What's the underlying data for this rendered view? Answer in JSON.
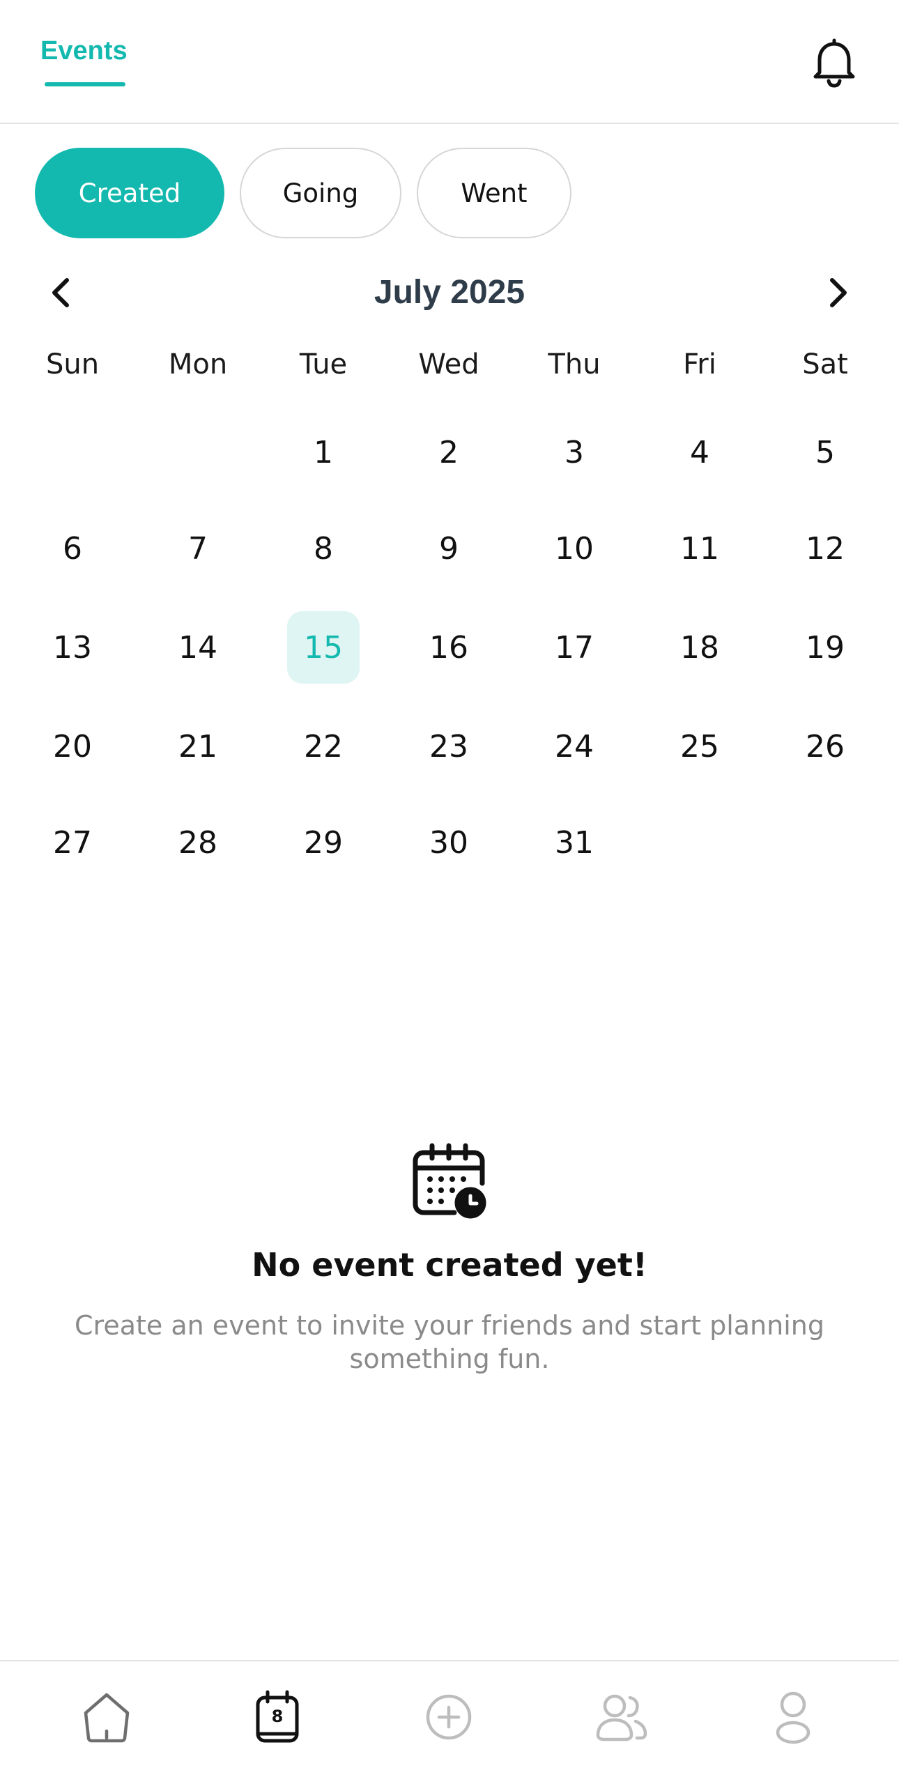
{
  "header": {
    "active_tab": "Events",
    "accent": "#13b9ae",
    "bell_icon": "bell-icon"
  },
  "filters": [
    {
      "label": "Created",
      "active": true
    },
    {
      "label": "Going",
      "active": false
    },
    {
      "label": "Went",
      "active": false
    }
  ],
  "calendar": {
    "month_label": "July 2025",
    "prev_icon": "chevron-left-icon",
    "next_icon": "chevron-right-icon",
    "weekdays": [
      "Sun",
      "Mon",
      "Tue",
      "Wed",
      "Thu",
      "Fri",
      "Sat"
    ],
    "days": [
      "",
      "",
      "1",
      "2",
      "3",
      "4",
      "5",
      "6",
      "7",
      "8",
      "9",
      "10",
      "11",
      "12",
      "13",
      "14",
      "15",
      "16",
      "17",
      "18",
      "19",
      "20",
      "21",
      "22",
      "23",
      "24",
      "25",
      "26",
      "27",
      "28",
      "29",
      "30",
      "31",
      "",
      ""
    ],
    "selected_day": "15"
  },
  "empty_state": {
    "icon": "calendar-clock-icon",
    "title": "No event created yet!",
    "description": "Create an event to invite your friends and start planning something fun."
  },
  "bottom_nav": {
    "items": [
      {
        "icon": "home-icon",
        "active": false
      },
      {
        "icon": "calendar-icon",
        "badge": "8",
        "active": true
      },
      {
        "icon": "add-circle-icon",
        "active": false
      },
      {
        "icon": "friends-icon",
        "active": false
      },
      {
        "icon": "profile-icon",
        "active": false
      }
    ]
  }
}
